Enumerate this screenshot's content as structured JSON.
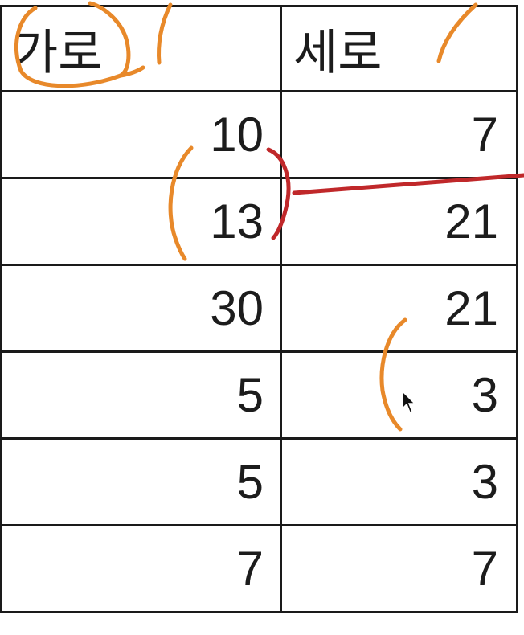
{
  "table": {
    "headers": [
      "가로",
      "세로"
    ],
    "rows": [
      [
        "10",
        "7"
      ],
      [
        "13",
        "21"
      ],
      [
        "30",
        "21"
      ],
      [
        "5",
        "3"
      ],
      [
        "5",
        "3"
      ],
      [
        "7",
        "7"
      ]
    ]
  },
  "annotations": {
    "orange": "#e8892a",
    "red": "#c0282a"
  }
}
